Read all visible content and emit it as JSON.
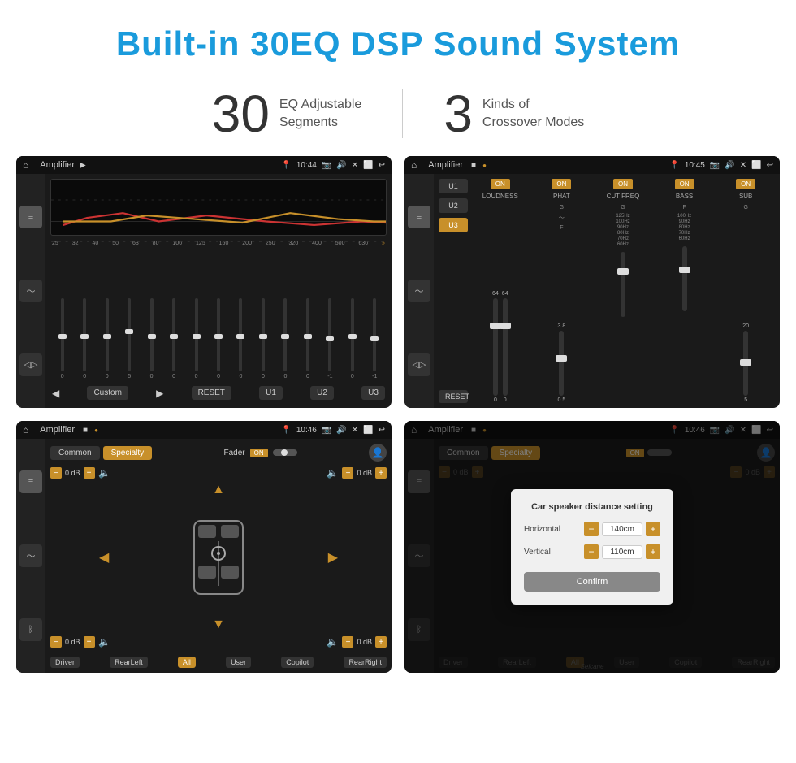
{
  "page": {
    "title": "Built-in 30EQ DSP Sound System",
    "stat1_number": "30",
    "stat1_label_line1": "EQ Adjustable",
    "stat1_label_line2": "Segments",
    "stat2_number": "3",
    "stat2_label_line1": "Kinds of",
    "stat2_label_line2": "Crossover Modes"
  },
  "screen1": {
    "app_title": "Amplifier",
    "time": "10:44",
    "eq_labels": [
      "25",
      "32",
      "40",
      "50",
      "63",
      "80",
      "100",
      "125",
      "160",
      "200",
      "250",
      "320",
      "400",
      "500",
      "630"
    ],
    "eq_values": [
      "0",
      "0",
      "0",
      "5",
      "0",
      "0",
      "0",
      "0",
      "0",
      "0",
      "0",
      "0",
      "-1",
      "0",
      "-1"
    ],
    "bottom_btns": [
      "Custom",
      "RESET",
      "U1",
      "U2",
      "U3"
    ]
  },
  "screen2": {
    "app_title": "Amplifier",
    "time": "10:45",
    "presets": [
      "U1",
      "U2",
      "U3"
    ],
    "active_preset": "U3",
    "channels": [
      "LOUDNESS",
      "PHAT",
      "CUT FREQ",
      "BASS",
      "SUB"
    ],
    "toggle_state": "ON",
    "reset_label": "RESET"
  },
  "screen3": {
    "app_title": "Amplifier",
    "time": "10:46",
    "mode_btns": [
      "Common",
      "Specialty"
    ],
    "active_mode": "Specialty",
    "fader_label": "Fader",
    "fader_on": "ON",
    "channel_labels": [
      "Driver",
      "RearLeft",
      "Copilot",
      "RearRight"
    ],
    "vol_labels": [
      "0 dB",
      "0 dB",
      "0 dB",
      "0 dB"
    ],
    "speaker_btns": [
      "Driver",
      "RearLeft",
      "All",
      "User",
      "Copilot",
      "RearRight"
    ],
    "active_speaker": "All"
  },
  "screen4": {
    "app_title": "Amplifier",
    "time": "10:46",
    "mode_btns": [
      "Common",
      "Specialty"
    ],
    "active_mode": "Specialty",
    "dialog_title": "Car speaker distance setting",
    "horizontal_label": "Horizontal",
    "horizontal_value": "140cm",
    "vertical_label": "Vertical",
    "vertical_value": "110cm",
    "confirm_label": "Confirm",
    "vol_labels": [
      "0 dB",
      "0 dB"
    ],
    "channel_labels": [
      "Driver",
      "RearLeft",
      "Copilot",
      "RearRight"
    ],
    "speaker_btns": [
      "Driver",
      "RearLeft",
      "All",
      "User",
      "Copilot",
      "RearRight"
    ],
    "watermark": "Seicane"
  }
}
